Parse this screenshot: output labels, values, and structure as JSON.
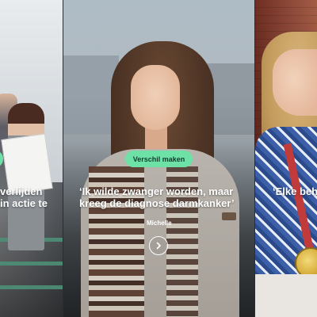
{
  "cards": {
    "left": {
      "tag_label": "",
      "quote_line1": "verlijden",
      "quote_line2": " in actie te"
    },
    "main": {
      "tag_label": "Verschil maken",
      "quote_line1": "‘Ik wilde zwanger worden, maar",
      "quote_line2": "kreeg de diagnose darmkanker’",
      "author": "Michelle"
    },
    "right": {
      "quote_line1": "‘Elke beh"
    }
  },
  "icons": {
    "next": "chevron-right-icon"
  },
  "colors": {
    "tag_background": "#6ee2a6",
    "tag_text": "#0f3d2d",
    "text": "#ffffff"
  }
}
